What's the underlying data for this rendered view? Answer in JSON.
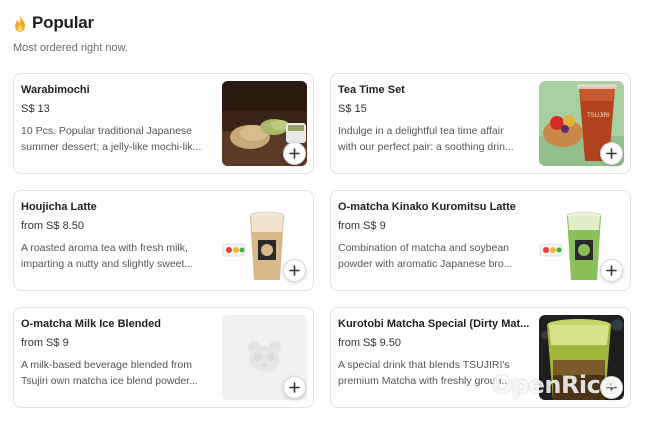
{
  "section": {
    "title": "Popular",
    "subtitle": "Most ordered right now."
  },
  "items": [
    {
      "name": "Warabimochi",
      "price": "S$ 13",
      "desc_line1": "10 Pcs. Popular traditional Japanese",
      "desc_line2": "summer dessert; a jelly-like mochi-lik...",
      "image": "warabimochi-photo"
    },
    {
      "name": "Tea Time Set",
      "price": "S$ 15",
      "desc_line1": "Indulge in a delightful tea time affair",
      "desc_line2": "with our perfect pair: a soothing drin...",
      "image": "tea-time-set-photo"
    },
    {
      "name": "Houjicha Latte",
      "price": "from S$ 8.50",
      "desc_line1": "A roasted aroma tea with fresh milk,",
      "desc_line2": "imparting a nutty and slightly sweet...",
      "image": "houjicha-latte-photo"
    },
    {
      "name": "O-matcha Kinako Kuromitsu Latte",
      "price": "from S$ 9",
      "desc_line1": "Combination of matcha and soybean",
      "desc_line2": "powder with aromatic Japanese bro...",
      "image": "matcha-kinako-latte-photo"
    },
    {
      "name": "O-matcha Milk Ice Blended",
      "price": "from S$ 9",
      "desc_line1": "A milk-based beverage blended from",
      "desc_line2": "Tsujiri own matcha ice blend powder...",
      "image": "placeholder-panda-icon"
    },
    {
      "name": "Kurotobi Matcha Special (Dirty Mat...",
      "price": "from S$ 9.50",
      "desc_line1": "A special drink that blends TSUJIRI's",
      "desc_line2": "premium Matcha with freshly groun...",
      "image": "kurotobi-matcha-photo"
    }
  ],
  "watermark": "OpenRice",
  "colors": {
    "fire": "#f5a623",
    "card_border": "#e2e2e2",
    "matcha": "#8bbf5a",
    "houjicha": "#d9b98c"
  }
}
